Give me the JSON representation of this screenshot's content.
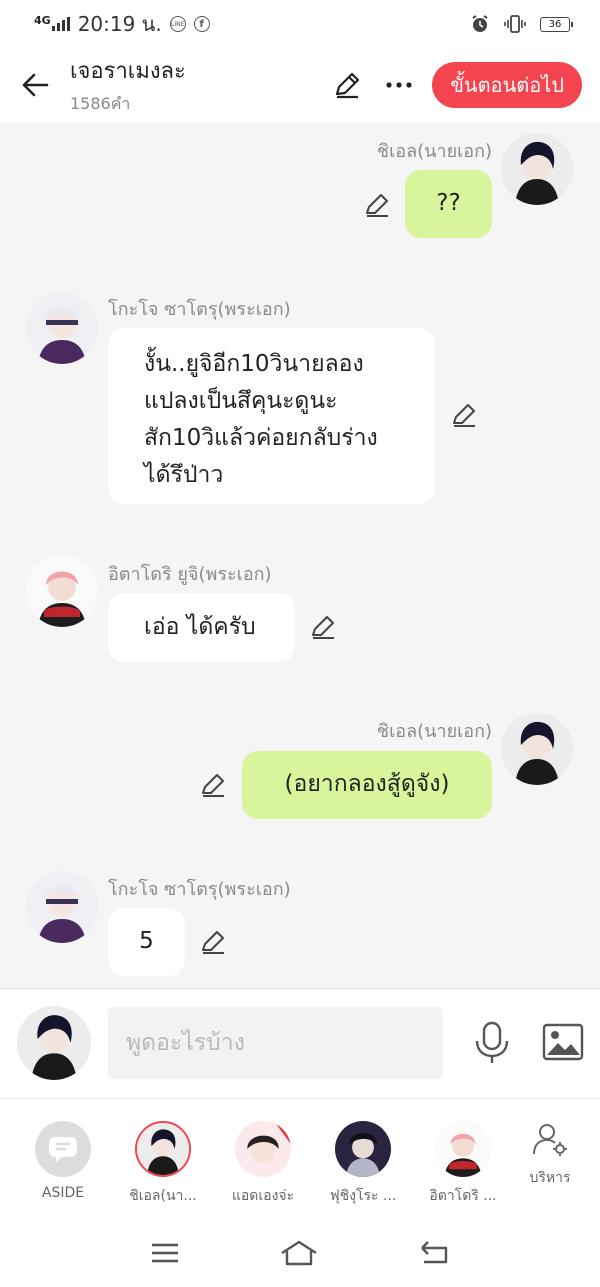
{
  "status_bar": {
    "network": "4G",
    "time": "20:19 น.",
    "battery": "36"
  },
  "header": {
    "title": "เจอราเมงละ",
    "word_count": "1586คำ",
    "next_label": "ขั้นตอนต่อไป"
  },
  "messages": [
    {
      "sender": "ชิเอล(นายเอก)",
      "text": "??",
      "side": "right"
    },
    {
      "sender": "โกะโจ ซาโตรุ(พระเอก)",
      "lines": [
        "งั้น..ยูจิอีก10วินายลอง",
        "แปลงเป็นสึคุนะดูนะ",
        "สัก10วิแล้วค่อยกลับร่าง",
        "ได้รึป่าว"
      ],
      "side": "left"
    },
    {
      "sender": "อิตาโดริ ยูจิ(พระเอก)",
      "text": "เอ่อ ได้ครับ",
      "side": "left"
    },
    {
      "sender": "ชิเอล(นายเอก)",
      "text": "(อยากลองสู้ดูจัง)",
      "side": "right"
    },
    {
      "sender": "โกะโจ ซาโตรุ(พระเอก)",
      "text": "5",
      "side": "left"
    }
  ],
  "composer": {
    "placeholder": "พูดอะไรบ้าง"
  },
  "characters": [
    {
      "label": "ASIDE",
      "icon": "aside-bubble-icon"
    },
    {
      "label": "ชิเอล(นา...",
      "selected": true
    },
    {
      "label": "แอดเองจ่ะ"
    },
    {
      "label": "ฟุชิงุโระ ..."
    },
    {
      "label": "อิตาโดริ ..."
    }
  ],
  "manage_label": "บริหาร",
  "colors": {
    "accent": "#f44450",
    "bubble_self": "#d9f59b",
    "bubble_other": "#ffffff",
    "background": "#f5f5f5"
  }
}
